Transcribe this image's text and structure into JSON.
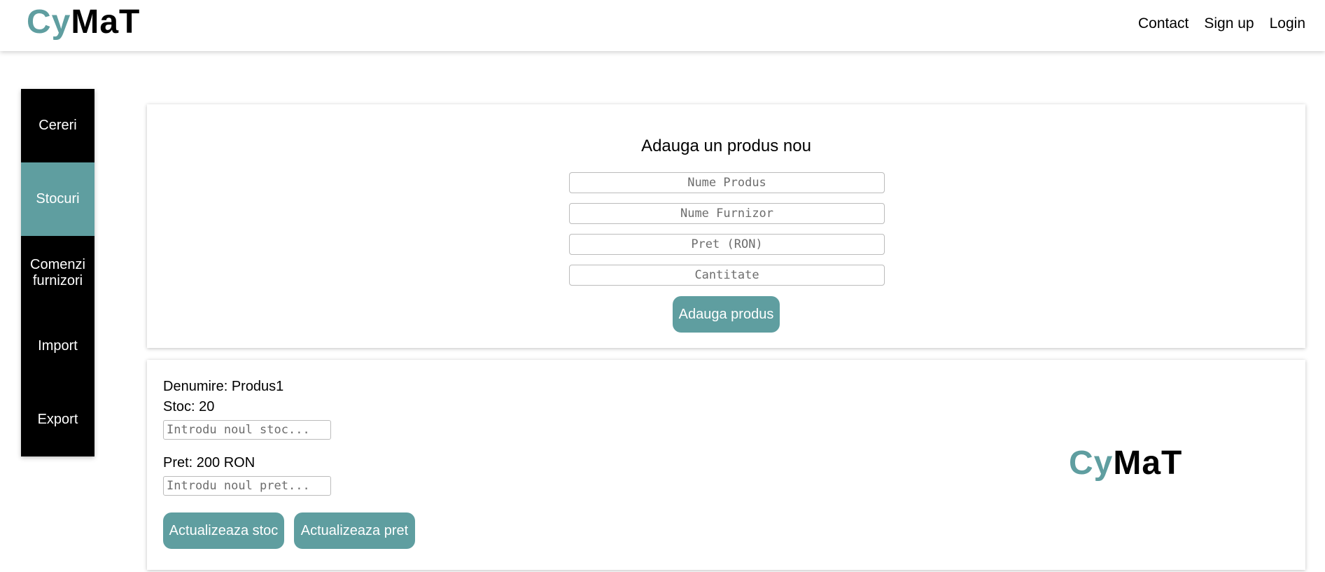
{
  "header": {
    "logo_part1": "Cy",
    "logo_part2": "MaT",
    "nav": [
      "Contact",
      "Sign up",
      "Login"
    ]
  },
  "sidebar": {
    "items": [
      {
        "label": "Cereri",
        "active": false
      },
      {
        "label": "Stocuri",
        "active": true
      },
      {
        "label": "Comenzi furnizori",
        "active": false
      },
      {
        "label": "Import",
        "active": false
      },
      {
        "label": "Export",
        "active": false
      }
    ]
  },
  "add_product": {
    "title": "Adauga un produs nou",
    "placeholders": {
      "name": "Nume Produs",
      "supplier": "Nume Furnizor",
      "price": "Pret (RON)",
      "quantity": "Cantitate"
    },
    "submit_label": "Adauga produs"
  },
  "product": {
    "name_line": "Denumire: Produs1",
    "stock_line": "Stoc: 20",
    "stock_placeholder": "Introdu noul stoc...",
    "price_line": "Pret: 200 RON",
    "price_placeholder": "Introdu noul pret...",
    "update_stock_label": "Actualizeaza stoc",
    "update_price_label": "Actualizeaza pret",
    "logo_part1": "Cy",
    "logo_part2": "MaT"
  },
  "colors": {
    "accent": "#5f9ea0",
    "sidebar_bg": "#000000"
  }
}
